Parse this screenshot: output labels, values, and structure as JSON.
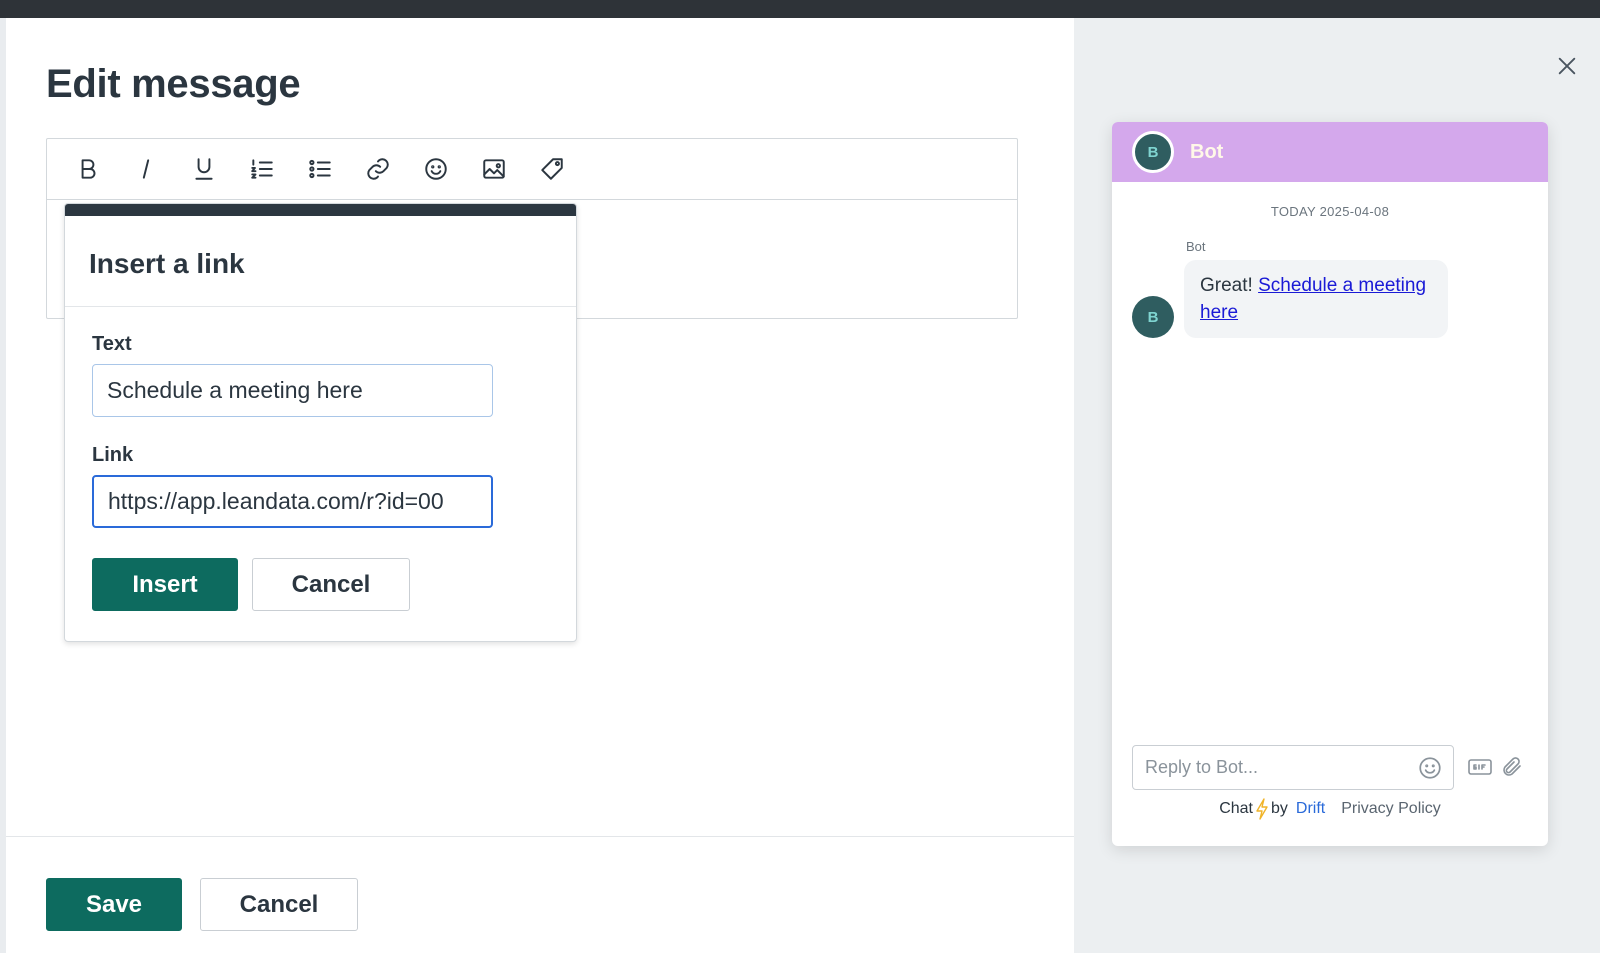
{
  "modal": {
    "title": "Edit message",
    "close_icon": "close-icon"
  },
  "toolbar": {
    "buttons": [
      {
        "name": "bold",
        "icon": "bold-icon"
      },
      {
        "name": "italic",
        "icon": "italic-icon"
      },
      {
        "name": "underline",
        "icon": "underline-icon"
      },
      {
        "name": "ordered-list",
        "icon": "ordered-list-icon"
      },
      {
        "name": "bullet-list",
        "icon": "bullet-list-icon"
      },
      {
        "name": "link",
        "icon": "link-icon"
      },
      {
        "name": "emoji",
        "icon": "emoji-icon"
      },
      {
        "name": "image",
        "icon": "image-icon"
      },
      {
        "name": "tag",
        "icon": "tag-icon"
      }
    ]
  },
  "link_popover": {
    "title": "Insert a link",
    "text_label": "Text",
    "text_value": "Schedule a meeting here",
    "link_label": "Link",
    "link_value": "https://app.leandata.com/r?id=00",
    "insert_label": "Insert",
    "cancel_label": "Cancel"
  },
  "footer": {
    "save_label": "Save",
    "cancel_label": "Cancel"
  },
  "chat": {
    "header_name": "Bot",
    "avatar_initial": "B",
    "date_label": "TODAY 2025-04-08",
    "sender": "Bot",
    "message_prefix": "Great! ",
    "message_link": "Schedule a meeting here",
    "compose_placeholder": "Reply to Bot...",
    "footer_chat": "Chat",
    "footer_by": "by",
    "footer_brand": "Drift",
    "footer_privacy": "Privacy Policy",
    "colors": {
      "header_bg": "#d4a8ec",
      "avatar_bg": "#2f5d60",
      "link": "#1a1ad6"
    }
  },
  "colors": {
    "primary": "#0d6b5f",
    "text": "#2b3640",
    "focus": "#2a6ad9"
  }
}
